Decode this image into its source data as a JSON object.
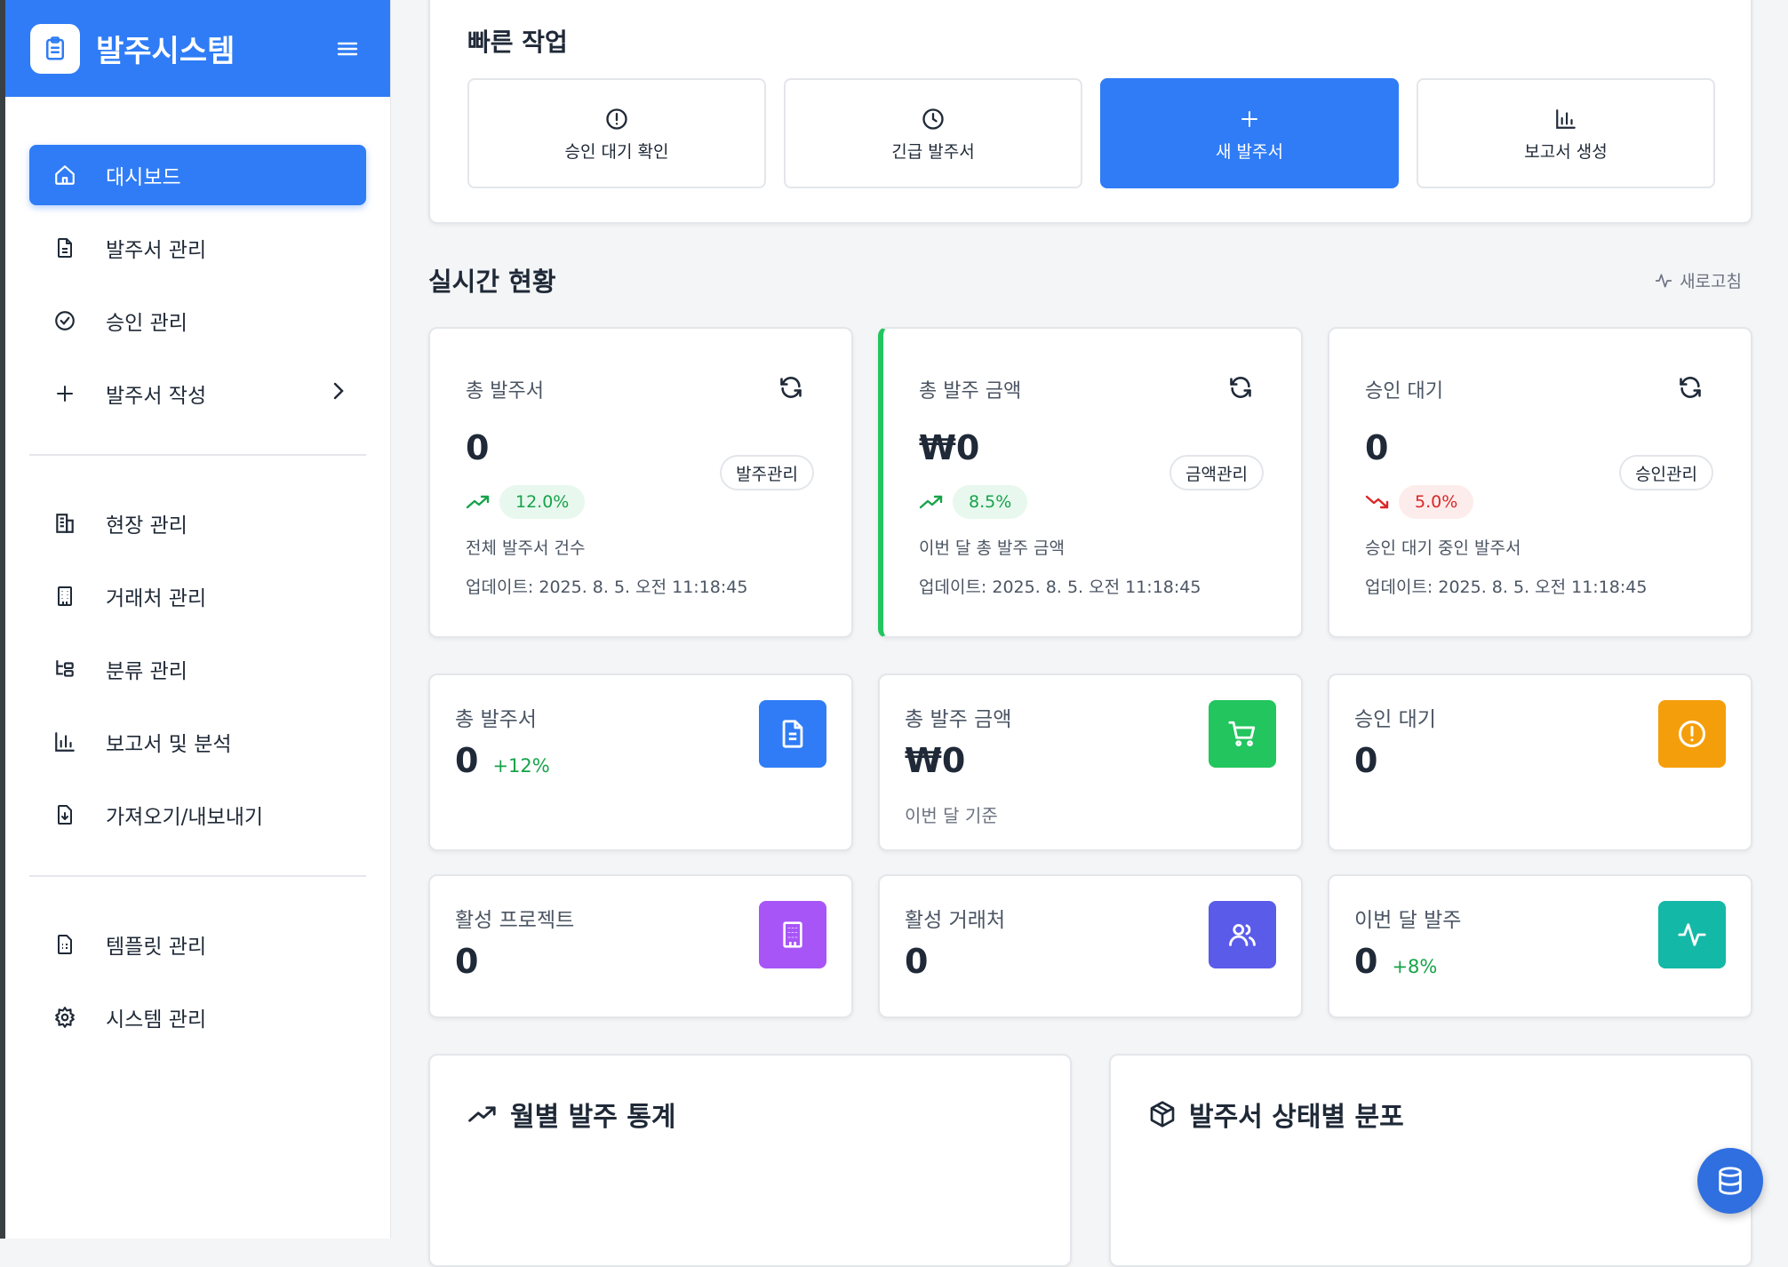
{
  "app": {
    "title": "발주시스템"
  },
  "sidebar": {
    "items": [
      {
        "label": "대시보드",
        "icon": "home-icon",
        "active": true
      },
      {
        "label": "발주서 관리",
        "icon": "document-icon"
      },
      {
        "label": "승인 관리",
        "icon": "check-circle-icon"
      },
      {
        "label": "발주서 작성",
        "icon": "plus-icon",
        "chevron": true
      },
      {
        "label": "현장 관리",
        "icon": "building-icon"
      },
      {
        "label": "거래처 관리",
        "icon": "office-icon"
      },
      {
        "label": "분류 관리",
        "icon": "tree-icon"
      },
      {
        "label": "보고서 및 분석",
        "icon": "bar-chart-icon"
      },
      {
        "label": "가져오기/내보내기",
        "icon": "import-export-icon"
      },
      {
        "label": "템플릿 관리",
        "icon": "template-icon"
      },
      {
        "label": "시스템 관리",
        "icon": "gear-icon"
      }
    ]
  },
  "quick_actions": {
    "title": "빠른 작업",
    "buttons": [
      {
        "label": "승인 대기 확인",
        "icon": "alert-circle-icon"
      },
      {
        "label": "긴급 발주서",
        "icon": "clock-icon"
      },
      {
        "label": "새 발주서",
        "icon": "plus-icon"
      },
      {
        "label": "보고서 생성",
        "icon": "bar-chart-icon"
      }
    ]
  },
  "realtime": {
    "title": "실시간 현황",
    "refresh_label": "새로고침",
    "cards": [
      {
        "title": "총 발주서",
        "value": "0",
        "pill": "발주관리",
        "trend": "12.0%",
        "trend_dir": "up",
        "desc": "전체 발주서 건수",
        "updated": "업데이트: 2025. 8. 5. 오전 11:18:45"
      },
      {
        "title": "총 발주 금액",
        "value": "₩0",
        "pill": "금액관리",
        "trend": "8.5%",
        "trend_dir": "up",
        "desc": "이번 달 총 발주 금액",
        "updated": "업데이트: 2025. 8. 5. 오전 11:18:45"
      },
      {
        "title": "승인 대기",
        "value": "0",
        "pill": "승인관리",
        "trend": "5.0%",
        "trend_dir": "down",
        "desc": "승인 대기 중인 발주서",
        "updated": "업데이트: 2025. 8. 5. 오전 11:18:45"
      }
    ]
  },
  "kpis": [
    {
      "title": "총 발주서",
      "value": "0",
      "delta": "+12%",
      "sub": "",
      "icon": "document-icon",
      "color": "#2f7cf6"
    },
    {
      "title": "총 발주 금액",
      "value": "₩0",
      "delta": "",
      "sub": "이번 달 기준",
      "icon": "cart-icon",
      "color": "#22c55e"
    },
    {
      "title": "승인 대기",
      "value": "0",
      "delta": "",
      "sub": "",
      "icon": "alert-circle-icon",
      "color": "#f59e0b"
    },
    {
      "title": "활성 프로젝트",
      "value": "0",
      "delta": "",
      "sub": "",
      "icon": "building-icon",
      "color": "#a855f7"
    },
    {
      "title": "활성 거래처",
      "value": "0",
      "delta": "",
      "sub": "",
      "icon": "users-icon",
      "color": "#5b5bea"
    },
    {
      "title": "이번 달 발주",
      "value": "0",
      "delta": "+8%",
      "sub": "",
      "icon": "activity-icon",
      "color": "#14b8a6"
    }
  ],
  "panels": [
    {
      "title": "월별 발주 통계",
      "icon": "trending-up-icon"
    },
    {
      "title": "발주서 상태별 분포",
      "icon": "package-icon"
    }
  ],
  "colors": {
    "primary": "#2f7cf6",
    "success": "#16a34a",
    "danger": "#dc2626"
  }
}
